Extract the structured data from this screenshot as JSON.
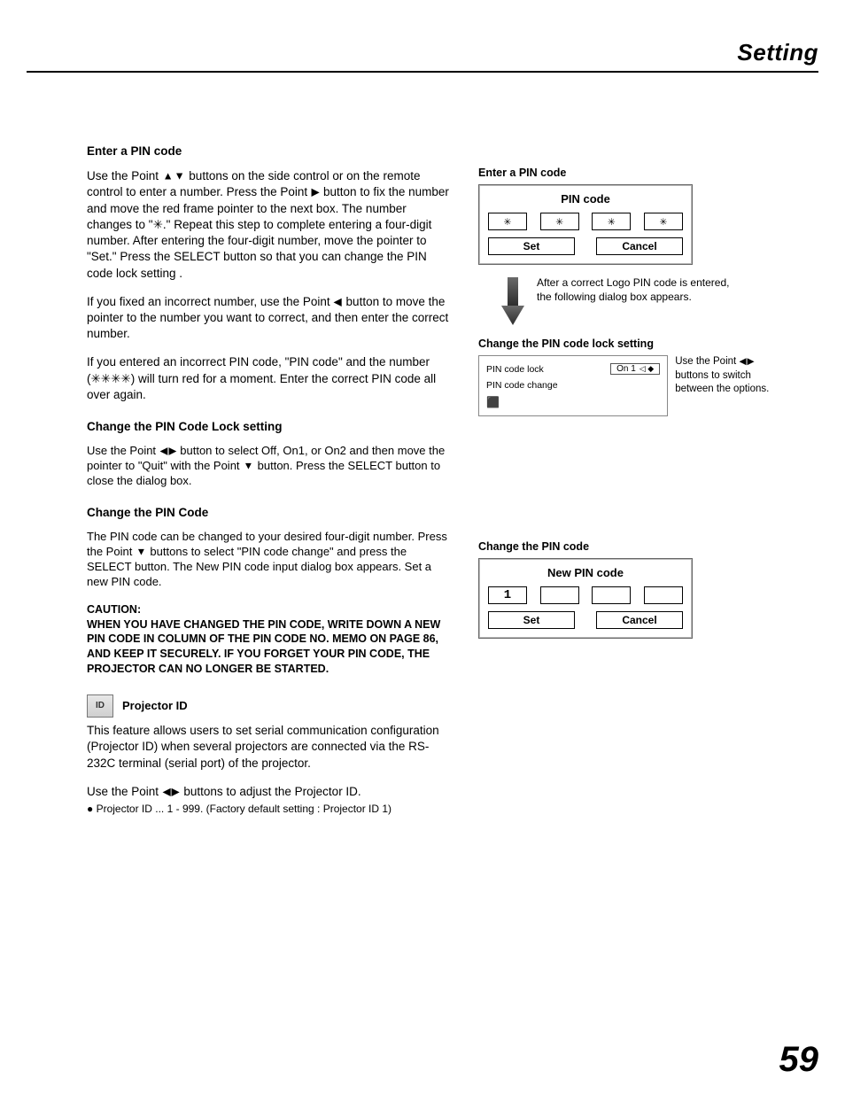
{
  "header": {
    "title": "Setting"
  },
  "page_number": "59",
  "left": {
    "h1": "Enter a PIN code",
    "p1a": "Use the Point ",
    "p1b": " buttons on the side control or on the remote control to enter a number. Press the Point ",
    "p1c": " button to fix the number and move the red frame pointer to the next box. The number changes to \"✳.\" Repeat this step to complete entering a four-digit number. After entering the four-digit number, move the pointer to \"Set.\" Press the SELECT button so that you can change the PIN code lock setting .",
    "p2a": " If you fixed an incorrect number, use the Point ",
    "p2b": " button to move the pointer to the number you want to correct, and then enter the correct number.",
    "p3": "If you entered an incorrect PIN code, \"PIN code\" and the number (✳✳✳✳) will turn red for a moment. Enter the correct PIN code all over again.",
    "h2": "Change the PIN Code Lock setting",
    "p4a": "Use the Point ",
    "p4b": " button to select Off, On1, or On2 and then move the pointer to \"Quit\" with the Point ",
    "p4c": " button. Press the SELECT button to close the dialog box.",
    "h3": "Change the PIN Code",
    "p5a": "The PIN code can be changed to your desired four-digit number. Press the Point ",
    "p5b": " buttons to select \"PIN code change\" and press the SELECT button. The New PIN code input dialog box appears. Set a new PIN code.",
    "caution_label": "CAUTION:",
    "caution": "WHEN YOU HAVE CHANGED THE PIN CODE, WRITE DOWN A NEW PIN CODE IN COLUMN OF THE PIN CODE NO. MEMO ON PAGE 86, AND KEEP IT SECURELY. IF YOU FORGET YOUR PIN CODE, THE PROJECTOR CAN NO LONGER BE STARTED.",
    "proj_icon_text": "ID",
    "proj_title": "Projector ID",
    "p6": "This feature allows users to set serial communication configuration (Projector ID) when several projectors are connected via the RS-232C terminal (serial port) of the projector.",
    "p7a": "Use the Point ",
    "p7b": " buttons to adjust the Projector ID.",
    "p8": "● Projector ID ... 1 - 999. (Factory default setting : Projector ID 1)"
  },
  "right": {
    "sec1_title": "Enter a PIN code",
    "pin_dialog": {
      "title": "PIN code",
      "cells": [
        "✳",
        "✳",
        "✳",
        "✳"
      ],
      "set": "Set",
      "cancel": "Cancel"
    },
    "arrow_text": "After a correct Logo PIN code is entered, the following dialog box appears.",
    "sec2_title": "Change the PIN code lock setting",
    "lock": {
      "row1": "PIN code lock",
      "on1": "On 1",
      "row2": "PIN code change"
    },
    "lock_note_a": "Use the Point ",
    "lock_note_b": " buttons to switch between the options.",
    "sec3_title": "Change the PIN code",
    "new_dialog": {
      "title": "New PIN code",
      "cells": [
        "1",
        "",
        "",
        ""
      ],
      "set": "Set",
      "cancel": "Cancel"
    }
  }
}
